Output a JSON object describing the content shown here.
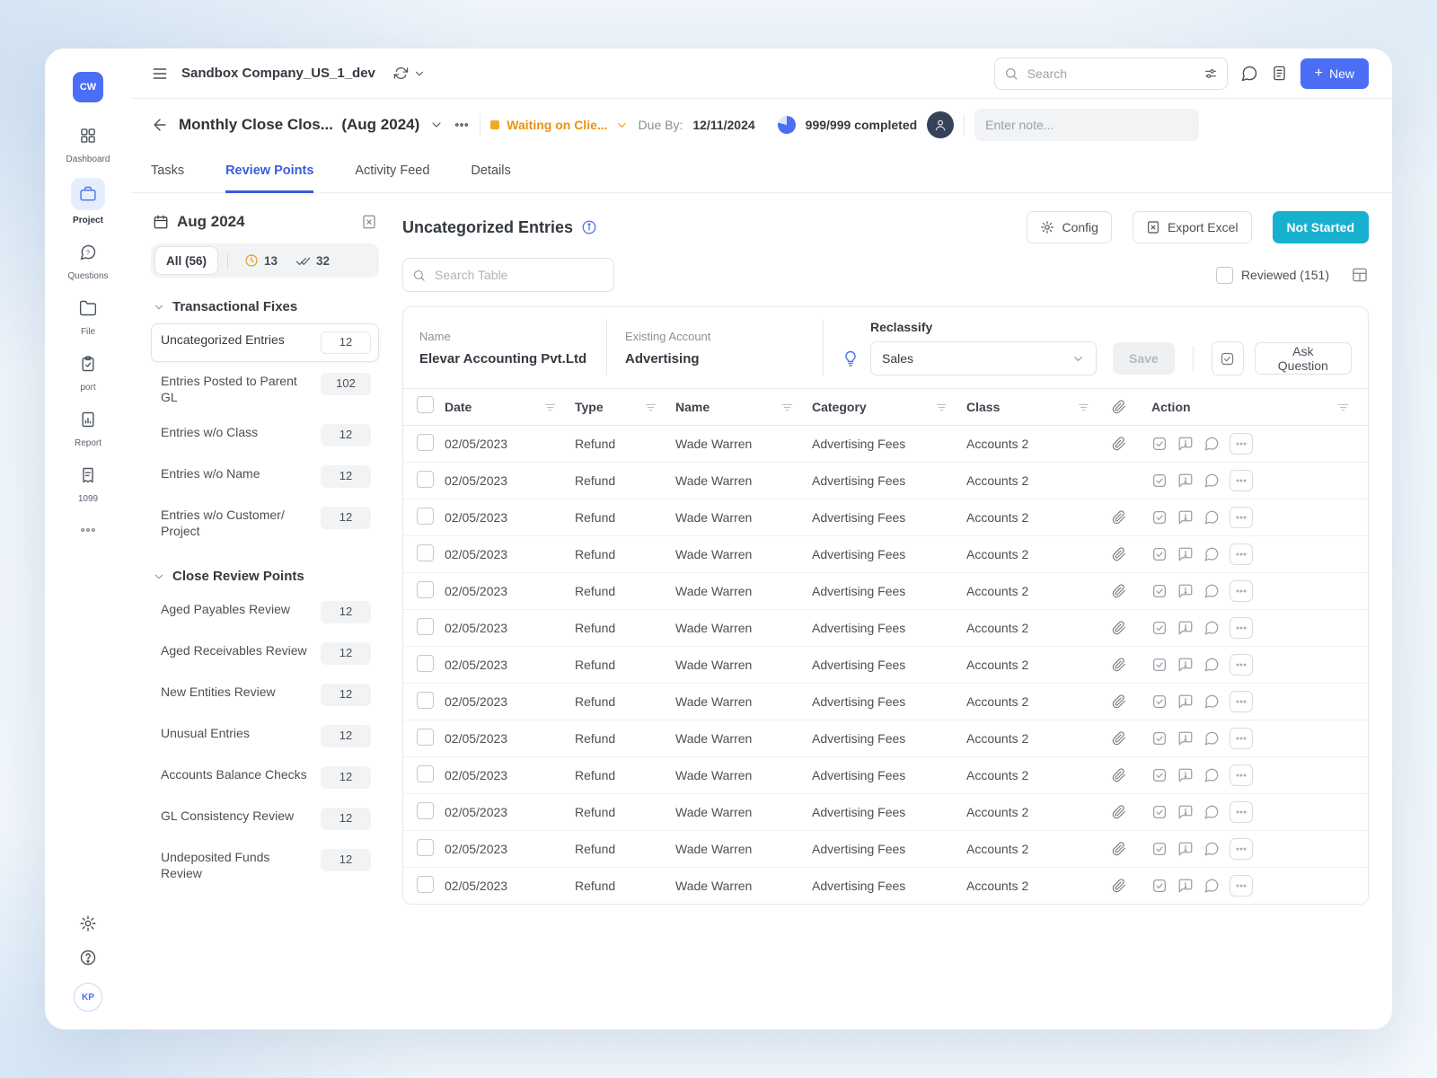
{
  "colors": {
    "accent": "#4c6ef5",
    "tab_active": "#3b5bdb",
    "status_orange": "#e8930c",
    "status_square": "#f5a623",
    "teal": "#18b0cf",
    "badge_bg": "#f1f3f5"
  },
  "sidebar": {
    "logo_text": "CW",
    "items": [
      {
        "label": "Dashboard",
        "icon": "dashboard-icon",
        "active": false
      },
      {
        "label": "Project",
        "icon": "briefcase-icon",
        "active": true
      },
      {
        "label": "Questions",
        "icon": "question-bubble-icon",
        "active": false
      },
      {
        "label": "File",
        "icon": "folder-icon",
        "active": false
      },
      {
        "label": "port",
        "icon": "clipboard-check-icon",
        "active": false
      },
      {
        "label": "Report",
        "icon": "report-icon",
        "active": false
      },
      {
        "label": "1099",
        "icon": "receipt-icon",
        "active": false
      }
    ],
    "footer_avatar_text": "KP"
  },
  "topbar": {
    "company_name": "Sandbox Company_US_1_dev",
    "search_placeholder": "Search",
    "new_button_label": "New",
    "plus_glyph": "+"
  },
  "header": {
    "title": "Monthly Close Clos...",
    "period": "(Aug 2024)",
    "status_label": "Waiting on Clie...",
    "due_by_label": "Due By:",
    "due_date": "12/11/2024",
    "progress_label": "999/999 completed",
    "note_placeholder": "Enter note..."
  },
  "tabs": [
    {
      "label": "Tasks",
      "active": false
    },
    {
      "label": "Review Points",
      "active": true
    },
    {
      "label": "Activity Feed",
      "active": false
    },
    {
      "label": "Details",
      "active": false
    }
  ],
  "review_panel": {
    "month_label": "Aug 2024",
    "filter_all_label": "All (56)",
    "filter_pending_count": "13",
    "filter_reviewed_count": "32",
    "sections": {
      "transactional": {
        "title": "Transactional Fixes",
        "items": [
          {
            "label": "Uncategorized Entries",
            "count": "12",
            "active": true
          },
          {
            "label": "Entries Posted to Parent GL",
            "count": "102",
            "active": false
          },
          {
            "label": "Entries w/o Class",
            "count": "12",
            "active": false
          },
          {
            "label": "Entries w/o Name",
            "count": "12",
            "active": false
          },
          {
            "label": "Entries w/o Customer/ Project",
            "count": "12",
            "active": false
          }
        ]
      },
      "close_review": {
        "title": "Close Review Points",
        "items": [
          {
            "label": "Aged Payables Review",
            "count": "12",
            "active": false
          },
          {
            "label": "Aged Receivables Review",
            "count": "12",
            "active": false
          },
          {
            "label": "New Entities Review",
            "count": "12",
            "active": false
          },
          {
            "label": "Unusual Entries",
            "count": "12",
            "active": false
          },
          {
            "label": "Accounts Balance Checks",
            "count": "12",
            "active": false
          },
          {
            "label": "GL Consistency Review",
            "count": "12",
            "active": false
          },
          {
            "label": "Undeposited Funds Review",
            "count": "12",
            "active": false
          }
        ]
      }
    }
  },
  "main": {
    "title": "Uncategorized Entries",
    "config_label": "Config",
    "export_label": "Export Excel",
    "status_button_label": "Not Started",
    "table_search_placeholder": "Search Table",
    "reviewed_label": "Reviewed (151)",
    "reclassify": {
      "name_label": "Name",
      "name_value": "Elevar Accounting Pvt.Ltd",
      "account_label": "Existing Account",
      "account_value": "Advertising",
      "panel_label": "Reclassify",
      "select_value": "Sales",
      "save_label": "Save",
      "ask_question_label": "Ask Question"
    },
    "table": {
      "headers": {
        "date": "Date",
        "type": "Type",
        "name": "Name",
        "category": "Category",
        "class": "Class",
        "action": "Action"
      },
      "rows": [
        {
          "date": "02/05/2023",
          "type": "Refund",
          "name": "Wade Warren",
          "category": "Advertising Fees",
          "class": "Accounts 2",
          "attachment": true
        },
        {
          "date": "02/05/2023",
          "type": "Refund",
          "name": "Wade Warren",
          "category": "Advertising Fees",
          "class": "Accounts 2",
          "attachment": false
        },
        {
          "date": "02/05/2023",
          "type": "Refund",
          "name": "Wade Warren",
          "category": "Advertising Fees",
          "class": "Accounts 2",
          "attachment": true
        },
        {
          "date": "02/05/2023",
          "type": "Refund",
          "name": "Wade Warren",
          "category": "Advertising Fees",
          "class": "Accounts 2",
          "attachment": true
        },
        {
          "date": "02/05/2023",
          "type": "Refund",
          "name": "Wade Warren",
          "category": "Advertising Fees",
          "class": "Accounts 2",
          "attachment": true
        },
        {
          "date": "02/05/2023",
          "type": "Refund",
          "name": "Wade Warren",
          "category": "Advertising Fees",
          "class": "Accounts 2",
          "attachment": true
        },
        {
          "date": "02/05/2023",
          "type": "Refund",
          "name": "Wade Warren",
          "category": "Advertising Fees",
          "class": "Accounts 2",
          "attachment": true
        },
        {
          "date": "02/05/2023",
          "type": "Refund",
          "name": "Wade Warren",
          "category": "Advertising Fees",
          "class": "Accounts 2",
          "attachment": true
        },
        {
          "date": "02/05/2023",
          "type": "Refund",
          "name": "Wade Warren",
          "category": "Advertising Fees",
          "class": "Accounts 2",
          "attachment": true
        },
        {
          "date": "02/05/2023",
          "type": "Refund",
          "name": "Wade Warren",
          "category": "Advertising Fees",
          "class": "Accounts 2",
          "attachment": true
        },
        {
          "date": "02/05/2023",
          "type": "Refund",
          "name": "Wade Warren",
          "category": "Advertising Fees",
          "class": "Accounts 2",
          "attachment": true
        },
        {
          "date": "02/05/2023",
          "type": "Refund",
          "name": "Wade Warren",
          "category": "Advertising Fees",
          "class": "Accounts 2",
          "attachment": true
        },
        {
          "date": "02/05/2023",
          "type": "Refund",
          "name": "Wade Warren",
          "category": "Advertising Fees",
          "class": "Accounts 2",
          "attachment": true
        }
      ]
    }
  }
}
